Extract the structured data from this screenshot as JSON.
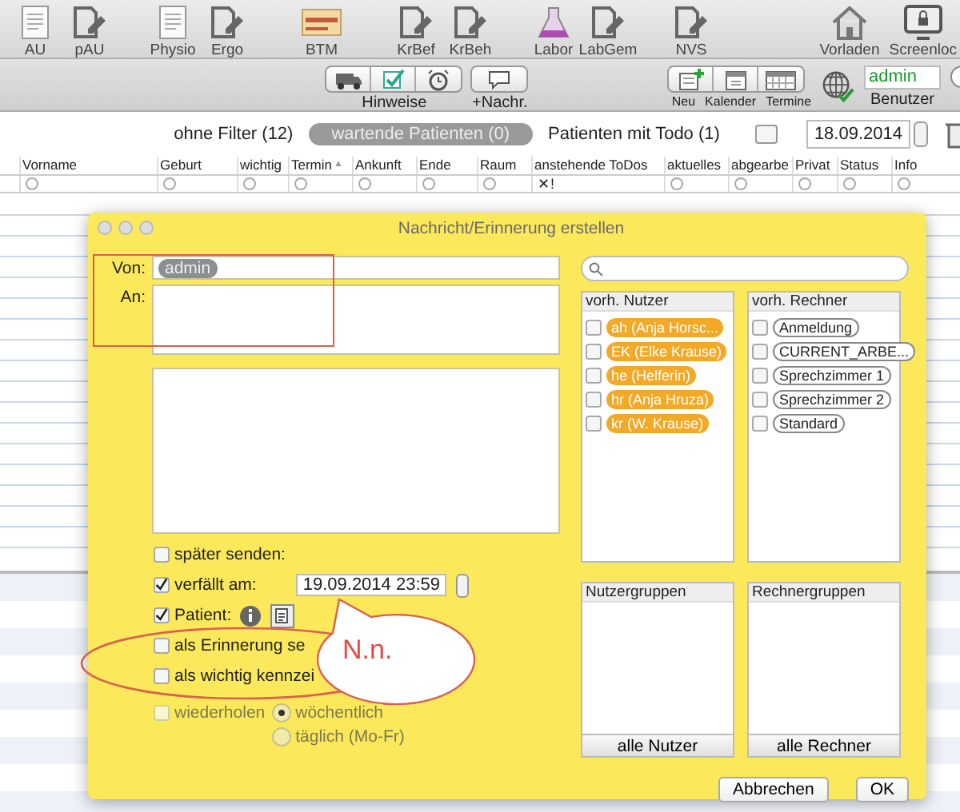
{
  "toolbar": {
    "groups": [
      [
        {
          "label": "AU",
          "kind": "form"
        },
        {
          "label": "pAU",
          "kind": "edit"
        }
      ],
      [
        {
          "label": "Physio",
          "kind": "form"
        },
        {
          "label": "Ergo",
          "kind": "edit"
        }
      ],
      [
        {
          "label": "BTM",
          "kind": "folder"
        }
      ],
      [
        {
          "label": "KrBef",
          "kind": "edit"
        },
        {
          "label": "KrBeh",
          "kind": "edit"
        }
      ],
      [
        {
          "label": "Labor",
          "kind": "flask"
        },
        {
          "label": "LabGem",
          "kind": "edit"
        }
      ],
      [
        {
          "label": "NVS",
          "kind": "edit"
        }
      ],
      [
        {
          "label": "Vorladen",
          "kind": "home"
        },
        {
          "label": "Screenloc",
          "kind": "lock"
        }
      ]
    ]
  },
  "subbar": {
    "hinweise": {
      "label": "Hinweise",
      "buttons": [
        {
          "kind": "van"
        },
        {
          "kind": "check"
        },
        {
          "kind": "alarm"
        }
      ]
    },
    "nachricht": {
      "label": "+Nachr."
    },
    "calendar": [
      {
        "label": "Neu",
        "kind": "new"
      },
      {
        "label": "Kalender",
        "kind": "day"
      },
      {
        "label": "Termine",
        "kind": "month"
      }
    ],
    "user": {
      "value": "admin",
      "label": "Benutzer"
    }
  },
  "filters": {
    "all": "ohne Filter (12)",
    "waiting": "wartende Patienten (0)",
    "todo": "Patienten mit Todo (1)",
    "date": "18.09.2014"
  },
  "table": {
    "columns": [
      {
        "label": "Vorname",
        "filter_selected": false
      },
      {
        "label": "Geburt",
        "filter_selected": false
      },
      {
        "label": "wichtig",
        "filter_selected": false
      },
      {
        "label": "Termin",
        "sort_mark": "▲",
        "filter_selected": false
      },
      {
        "label": "Ankunft",
        "filter_selected": false
      },
      {
        "label": "Ende",
        "filter_selected": false
      },
      {
        "label": "Raum",
        "filter_selected": false
      },
      {
        "label": "anstehende ToDos",
        "filter": "✕!"
      },
      {
        "label": "aktuelles",
        "filter_selected": false
      },
      {
        "label": "abgearbe",
        "filter_selected": false
      },
      {
        "label": "Privat",
        "filter_selected": false
      },
      {
        "label": "Status",
        "filter_selected": false
      },
      {
        "label": "Info",
        "filter_selected": false
      }
    ]
  },
  "dialog": {
    "title": "Nachricht/Erinnerung erstellen",
    "from_label": "Von:",
    "from": "admin",
    "to_label": "An:",
    "options": [
      {
        "kind": "check",
        "label": "später senden:",
        "checked": false
      },
      {
        "kind": "date",
        "label": "verfällt am:",
        "checked": true,
        "value": "19.09.2014 23:59"
      },
      {
        "kind": "patient",
        "label": "Patient:",
        "checked": true
      },
      {
        "kind": "check",
        "label": "als Erinnerung se",
        "checked": false
      },
      {
        "kind": "check",
        "label": "als wichtig kennzei",
        "checked": false
      },
      {
        "kind": "repeat",
        "label": "wiederholen",
        "checked": false,
        "disabled": true,
        "choices": [
          {
            "label": "wöchentlich",
            "selected": true
          },
          {
            "label": "täglich (Mo-Fr)",
            "selected": false
          }
        ]
      }
    ],
    "users": {
      "title": "vorh. Nutzer",
      "items": [
        {
          "label": "ah (Anja Horsc...",
          "checked": false
        },
        {
          "label": "EK (Elke Krause)",
          "checked": false
        },
        {
          "label": "he (Helferin)",
          "checked": false
        },
        {
          "label": "hr (Anja Hruza)",
          "checked": false
        },
        {
          "label": "kr (W. Krause)",
          "checked": false
        }
      ]
    },
    "computers": {
      "title": "vorh. Rechner",
      "items": [
        {
          "label": "Anmeldung",
          "checked": false
        },
        {
          "label": "CURRENT_ARBE...",
          "checked": false
        },
        {
          "label": "Sprechzimmer 1",
          "checked": false
        },
        {
          "label": "Sprechzimmer 2",
          "checked": false
        },
        {
          "label": "Standard",
          "checked": false
        }
      ]
    },
    "user_groups": {
      "title": "Nutzergruppen",
      "button": "alle Nutzer"
    },
    "computer_groups": {
      "title": "Rechnergruppen",
      "button": "alle Rechner"
    },
    "buttons": [
      "Abbrechen",
      "OK"
    ]
  },
  "annotation": {
    "bubble": "N.n."
  }
}
